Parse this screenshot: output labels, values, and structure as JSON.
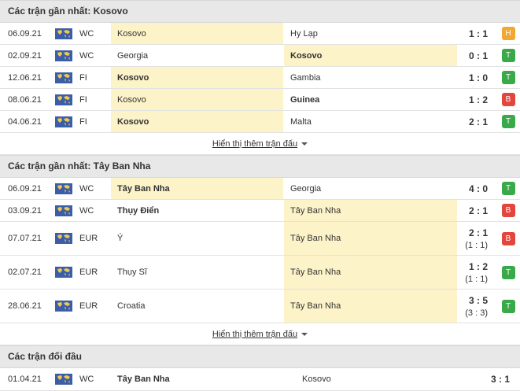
{
  "sections": [
    {
      "title": "Các trận gần nhất: Kosovo",
      "rows": [
        {
          "date": "06.09.21",
          "comp": "WC",
          "home": "Kosovo",
          "away": "Hy Lạp",
          "score": "1 : 1",
          "sub": "",
          "result": "H",
          "hl": "home",
          "bold": ""
        },
        {
          "date": "02.09.21",
          "comp": "WC",
          "home": "Georgia",
          "away": "Kosovo",
          "score": "0 : 1",
          "sub": "",
          "result": "T",
          "hl": "away",
          "bold": "away"
        },
        {
          "date": "12.06.21",
          "comp": "FI",
          "home": "Kosovo",
          "away": "Gambia",
          "score": "1 : 0",
          "sub": "",
          "result": "T",
          "hl": "home",
          "bold": "home"
        },
        {
          "date": "08.06.21",
          "comp": "FI",
          "home": "Kosovo",
          "away": "Guinea",
          "score": "1 : 2",
          "sub": "",
          "result": "B",
          "hl": "home",
          "bold": "away"
        },
        {
          "date": "04.06.21",
          "comp": "FI",
          "home": "Kosovo",
          "away": "Malta",
          "score": "2 : 1",
          "sub": "",
          "result": "T",
          "hl": "home",
          "bold": "home"
        }
      ],
      "more_label": "Hiển thị thêm trận đấu"
    },
    {
      "title": "Các trận gần nhất: Tây Ban Nha",
      "rows": [
        {
          "date": "06.09.21",
          "comp": "WC",
          "home": "Tây Ban Nha",
          "away": "Georgia",
          "score": "4 : 0",
          "sub": "",
          "result": "T",
          "hl": "home",
          "bold": "home"
        },
        {
          "date": "03.09.21",
          "comp": "WC",
          "home": "Thụy Điển",
          "away": "Tây Ban Nha",
          "score": "2 : 1",
          "sub": "",
          "result": "B",
          "hl": "away",
          "bold": "home"
        },
        {
          "date": "07.07.21",
          "comp": "EUR",
          "home": "Ý",
          "away": "Tây Ban Nha",
          "score": "2 : 1",
          "sub": "(1 : 1)",
          "result": "B",
          "hl": "away",
          "bold": ""
        },
        {
          "date": "02.07.21",
          "comp": "EUR",
          "home": "Thụy Sĩ",
          "away": "Tây Ban Nha",
          "score": "1 : 2",
          "sub": "(1 : 1)",
          "result": "T",
          "hl": "away",
          "bold": ""
        },
        {
          "date": "28.06.21",
          "comp": "EUR",
          "home": "Croatia",
          "away": "Tây Ban Nha",
          "score": "3 : 5",
          "sub": "(3 : 3)",
          "result": "T",
          "hl": "away",
          "bold": ""
        }
      ],
      "more_label": "Hiển thị thêm trận đấu"
    },
    {
      "title": "Các trận đối đầu",
      "rows": [
        {
          "date": "01.04.21",
          "comp": "WC",
          "home": "Tây Ban Nha",
          "away": "Kosovo",
          "score": "3 : 1",
          "sub": "",
          "result": "",
          "hl": "",
          "bold": "home"
        }
      ],
      "more_label": ""
    }
  ],
  "icons": {
    "competition": "world-map-icon",
    "more": "chevron-down-icon"
  },
  "colors": {
    "highlight": "#fdf3c8",
    "H": "#f0a830",
    "T": "#3aa94a",
    "B": "#e2463c",
    "header_bg": "#e8e8e8"
  }
}
